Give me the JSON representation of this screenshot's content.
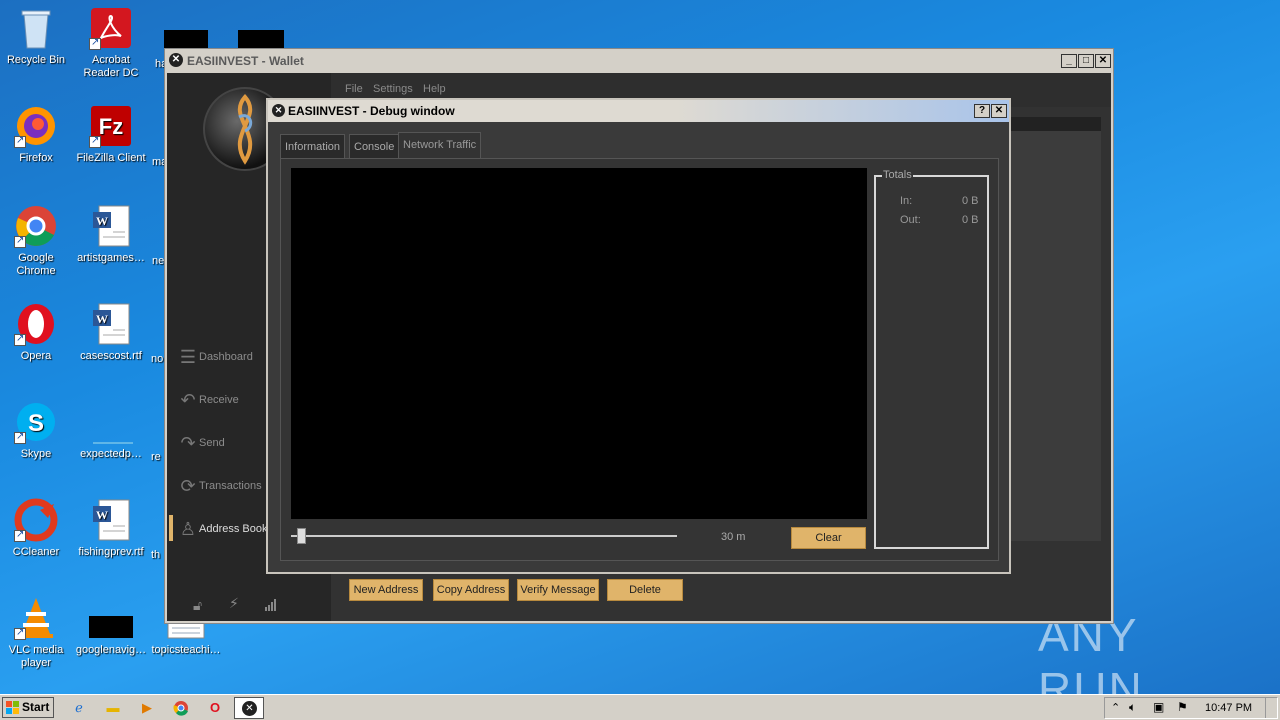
{
  "desktop": {
    "icons": [
      {
        "label": "Recycle Bin"
      },
      {
        "label": "Acrobat Reader DC"
      },
      {
        "label": "Firefox"
      },
      {
        "label": "FileZilla Client"
      },
      {
        "label": "Google Chrome"
      },
      {
        "label": "artistgames…"
      },
      {
        "label": "Opera"
      },
      {
        "label": "casescost.rtf"
      },
      {
        "label": "Skype"
      },
      {
        "label": "expectedp…"
      },
      {
        "label": "CCleaner"
      },
      {
        "label": "fishingprev.rtf"
      },
      {
        "label": "VLC media player"
      },
      {
        "label": "googlenavig…"
      },
      {
        "label": "topicsteachi…"
      }
    ],
    "partial_labels": [
      "ha",
      "ma",
      "ne",
      "no",
      "re",
      "th"
    ],
    "watermark": "ANY RUN"
  },
  "wallet": {
    "title": "EASIINVEST - Wallet",
    "menu": {
      "file": "File",
      "settings": "Settings",
      "help": "Help"
    },
    "nav": {
      "dashboard": "Dashboard",
      "receive": "Receive",
      "send": "Send",
      "transactions": "Transactions",
      "address_book": "Address Book"
    },
    "buttons": {
      "new_address": "New Address",
      "copy_address": "Copy Address",
      "verify_message": "Verify Message",
      "delete": "Delete"
    }
  },
  "debug": {
    "title": "EASIINVEST - Debug window",
    "help_btn": "?",
    "close_btn": "✕",
    "tabs": {
      "information": "Information",
      "console": "Console",
      "network": "Network Traffic"
    },
    "slider_value": "30 m",
    "clear": "Clear",
    "totals": {
      "title": "Totals",
      "in_label": "In:",
      "in_value": "0 B",
      "out_label": "Out:",
      "out_value": "0 B"
    }
  },
  "taskbar": {
    "start": "Start",
    "clock": "10:47 PM"
  },
  "colors": {
    "accent": "#e0b46a",
    "desktop": "#1a8ae0",
    "dark": "#2b2b2b"
  }
}
